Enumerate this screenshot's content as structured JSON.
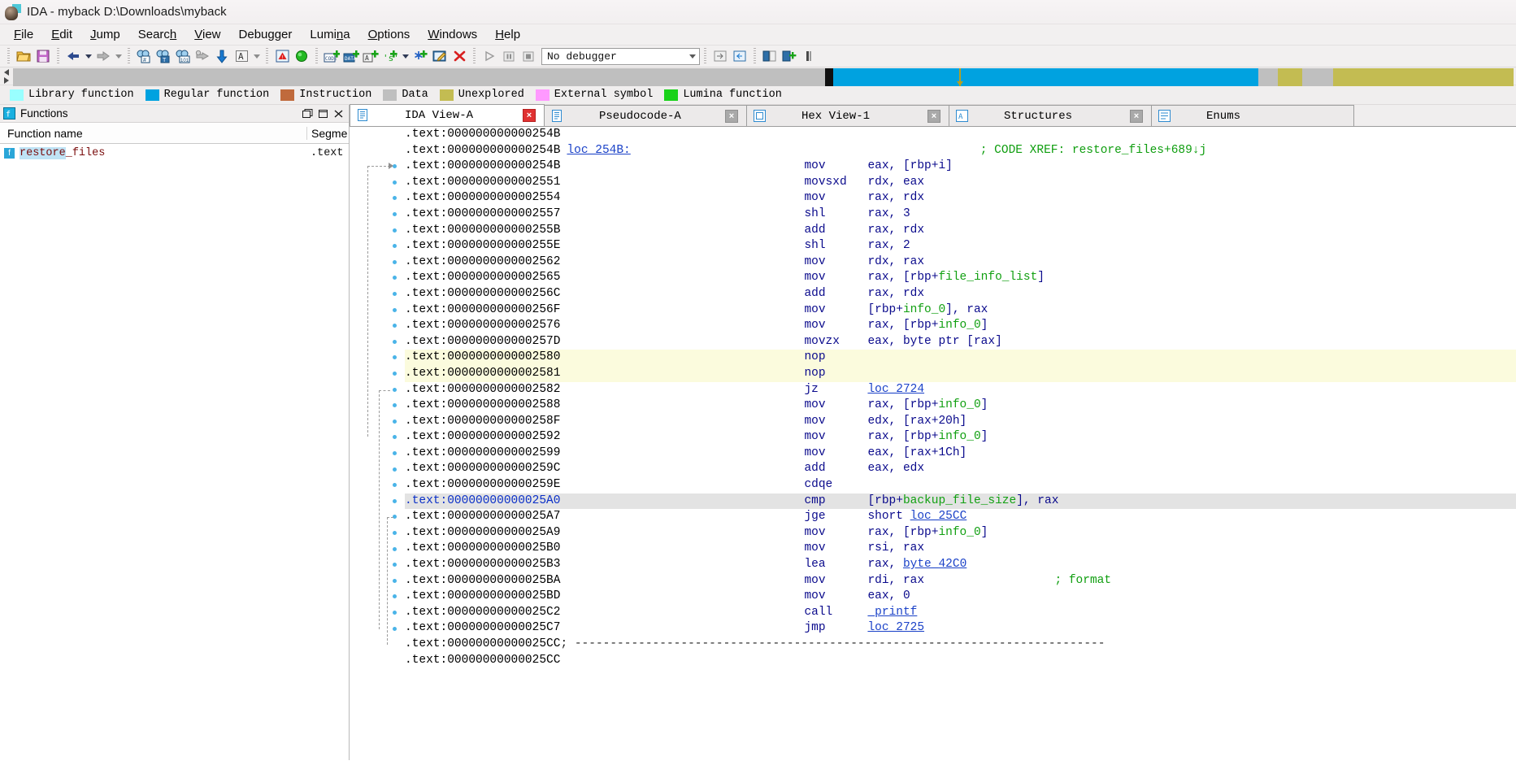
{
  "window": {
    "title": "IDA - myback D:\\Downloads\\myback",
    "icon": "ida-logo-icon"
  },
  "menubar": {
    "items": [
      {
        "label": "File",
        "accel": "F"
      },
      {
        "label": "Edit",
        "accel": "E"
      },
      {
        "label": "Jump",
        "accel": "J"
      },
      {
        "label": "Search",
        "accel": "h"
      },
      {
        "label": "View",
        "accel": "V"
      },
      {
        "label": "Debugger",
        "accel": "g"
      },
      {
        "label": "Lumina",
        "accel": "n"
      },
      {
        "label": "Options",
        "accel": "O"
      },
      {
        "label": "Windows",
        "accel": "W"
      },
      {
        "label": "Help",
        "accel": "H"
      }
    ]
  },
  "toolbar": {
    "open_label": "open-file",
    "save_label": "save",
    "back_label": "jump-back",
    "forward_label": "jump-forward",
    "search_code_label": "search-code",
    "search_text_label": "search-text",
    "search_seq_label": "search-sequence-of-bytes",
    "jump_xref_label": "jump-to-xref",
    "jump_down_label": "jump-to-address",
    "ascii_label": "ascii-string",
    "break_label": "breakpoint",
    "run_label": "run",
    "make_code_label": "make-code",
    "make_data_label": "make-data",
    "make_array_label": "make-array",
    "make_string_label": "make-string",
    "make_struct_label": "make-struct",
    "edit_label": "edit-function",
    "delete_label": "delete-function",
    "dbg_run_label": "debugger-run",
    "dbg_pause_label": "debugger-pause",
    "dbg_stop_label": "debugger-stop",
    "debugger_selected": "No debugger"
  },
  "navband": {
    "segments": [
      {
        "color": "#bfbfbf",
        "width_pct": 31.2,
        "name": "unexplored-region"
      },
      {
        "color": "#bfbfbf",
        "width_pct": 22.9,
        "name": "unexplored-region"
      },
      {
        "color": "#101010",
        "width_pct": 0.55,
        "name": "separator-region"
      },
      {
        "color": "#00a2e0",
        "width_pct": 16.6,
        "name": "regular-function-region"
      },
      {
        "color": "#00a2e0",
        "width_pct": 11.7,
        "name": "regular-function-region"
      },
      {
        "color": "#bfbfbf",
        "width_pct": 1.3,
        "name": "data-region"
      },
      {
        "color": "#c3bc52",
        "width_pct": 1.6,
        "name": "unexplored-region"
      },
      {
        "color": "#bfbfbf",
        "width_pct": 2.1,
        "name": "data-region"
      },
      {
        "color": "#c3bc52",
        "width_pct": 12.0,
        "name": "unexplored-region"
      }
    ],
    "cursor_pct": 63.0
  },
  "legend": {
    "items": [
      {
        "label": "Library function",
        "color": "#99ffff"
      },
      {
        "label": "Regular function",
        "color": "#00a2e0"
      },
      {
        "label": "Instruction",
        "color": "#c06a3c"
      },
      {
        "label": "Data",
        "color": "#bfbfbf"
      },
      {
        "label": "Unexplored",
        "color": "#c3bc52"
      },
      {
        "label": "External symbol",
        "color": "#ff99ff"
      },
      {
        "label": "Lumina function",
        "color": "#19d219"
      }
    ]
  },
  "functions_panel": {
    "title": "Functions",
    "icon": "functions-window-icon",
    "window_buttons": [
      "restore-icon",
      "maximize-icon",
      "close-icon"
    ],
    "columns": [
      "Function name",
      "Segme"
    ],
    "rows": [
      {
        "name_prefix": "restore",
        "name_suffix": "_files",
        "segment": ".text",
        "icon": "function-icon"
      }
    ]
  },
  "tabs": [
    {
      "label": "IDA View-A",
      "icon": "disassembly-icon",
      "active": true,
      "close": "close-icon"
    },
    {
      "label": "Pseudocode-A",
      "icon": "pseudocode-icon",
      "active": false,
      "close": "close-icon"
    },
    {
      "label": "Hex View-1",
      "icon": "hexview-icon",
      "active": false,
      "close": "close-icon"
    },
    {
      "label": "Structures",
      "icon": "structures-icon",
      "active": false,
      "close": "close-icon"
    },
    {
      "label": "Enums",
      "icon": "enums-icon",
      "active": false,
      "close": null
    }
  ],
  "disassembly": {
    "segment": ".text",
    "lines": [
      {
        "addr": ".text:000000000000254B",
        "text": "",
        "kind": "blank"
      },
      {
        "addr": ".text:000000000000254B",
        "label": "loc_254B:",
        "comment": "; CODE XREF: restore_files+689↓j",
        "kind": "label"
      },
      {
        "addr": ".text:000000000000254B",
        "mnemonic": "mov",
        "operands": "eax, [rbp+i]",
        "dot": true,
        "kind": "insn"
      },
      {
        "addr": ".text:0000000000002551",
        "mnemonic": "movsxd",
        "operands": "rdx, eax",
        "dot": true,
        "kind": "insn"
      },
      {
        "addr": ".text:0000000000002554",
        "mnemonic": "mov",
        "operands": "rax, rdx",
        "dot": true,
        "kind": "insn"
      },
      {
        "addr": ".text:0000000000002557",
        "mnemonic": "shl",
        "operands": "rax, 3",
        "dot": true,
        "kind": "insn"
      },
      {
        "addr": ".text:000000000000255B",
        "mnemonic": "add",
        "operands": "rax, rdx",
        "dot": true,
        "kind": "insn"
      },
      {
        "addr": ".text:000000000000255E",
        "mnemonic": "shl",
        "operands": "rax, 2",
        "dot": true,
        "kind": "insn"
      },
      {
        "addr": ".text:0000000000002562",
        "mnemonic": "mov",
        "operands": "rdx, rax",
        "dot": true,
        "kind": "insn"
      },
      {
        "addr": ".text:0000000000002565",
        "mnemonic": "mov",
        "operands": "rax, [rbp+file_info_list]",
        "var": "file_info_list",
        "dot": true,
        "kind": "insn"
      },
      {
        "addr": ".text:000000000000256C",
        "mnemonic": "add",
        "operands": "rax, rdx",
        "dot": true,
        "kind": "insn"
      },
      {
        "addr": ".text:000000000000256F",
        "mnemonic": "mov",
        "operands": "[rbp+info_0], rax",
        "var": "info_0",
        "dot": true,
        "kind": "insn"
      },
      {
        "addr": ".text:0000000000002576",
        "mnemonic": "mov",
        "operands": "rax, [rbp+info_0]",
        "var": "info_0",
        "dot": true,
        "kind": "insn"
      },
      {
        "addr": ".text:000000000000257D",
        "mnemonic": "movzx",
        "operands": "eax, byte ptr [rax]",
        "dot": true,
        "kind": "insn"
      },
      {
        "addr": ".text:0000000000002580",
        "mnemonic": "nop",
        "operands": "",
        "dot": true,
        "kind": "insn",
        "highlight": "yellow"
      },
      {
        "addr": ".text:0000000000002581",
        "mnemonic": "nop",
        "operands": "",
        "dot": true,
        "kind": "insn",
        "highlight": "yellow"
      },
      {
        "addr": ".text:0000000000002582",
        "mnemonic": "jz",
        "operands": "loc_2724",
        "jump": true,
        "dot": true,
        "kind": "insn"
      },
      {
        "addr": ".text:0000000000002588",
        "mnemonic": "mov",
        "operands": "rax, [rbp+info_0]",
        "var": "info_0",
        "dot": true,
        "kind": "insn"
      },
      {
        "addr": ".text:000000000000258F",
        "mnemonic": "mov",
        "operands": "edx, [rax+20h]",
        "dot": true,
        "kind": "insn"
      },
      {
        "addr": ".text:0000000000002592",
        "mnemonic": "mov",
        "operands": "rax, [rbp+info_0]",
        "var": "info_0",
        "dot": true,
        "kind": "insn"
      },
      {
        "addr": ".text:0000000000002599",
        "mnemonic": "mov",
        "operands": "eax, [rax+1Ch]",
        "dot": true,
        "kind": "insn"
      },
      {
        "addr": ".text:000000000000259C",
        "mnemonic": "add",
        "operands": "eax, edx",
        "dot": true,
        "kind": "insn"
      },
      {
        "addr": ".text:000000000000259E",
        "mnemonic": "cdqe",
        "operands": "",
        "dot": true,
        "kind": "insn"
      },
      {
        "addr": ".text:00000000000025A0",
        "mnemonic": "cmp",
        "operands": "[rbp+backup_file_size], rax",
        "var": "backup_file_size",
        "dot": true,
        "kind": "insn",
        "highlight": "selected"
      },
      {
        "addr": ".text:00000000000025A7",
        "mnemonic": "jge",
        "operands": "short loc_25CC",
        "jump": true,
        "dot": true,
        "kind": "insn"
      },
      {
        "addr": ".text:00000000000025A9",
        "mnemonic": "mov",
        "operands": "rax, [rbp+info_0]",
        "var": "info_0",
        "dot": true,
        "kind": "insn"
      },
      {
        "addr": ".text:00000000000025B0",
        "mnemonic": "mov",
        "operands": "rsi, rax",
        "dot": true,
        "kind": "insn"
      },
      {
        "addr": ".text:00000000000025B3",
        "mnemonic": "lea",
        "operands": "rax, byte_42C0",
        "jump": true,
        "dot": true,
        "kind": "insn"
      },
      {
        "addr": ".text:00000000000025BA",
        "mnemonic": "mov",
        "operands": "rdi, rax",
        "comment": "; format",
        "dot": true,
        "kind": "insn"
      },
      {
        "addr": ".text:00000000000025BD",
        "mnemonic": "mov",
        "operands": "eax, 0",
        "dot": true,
        "kind": "insn"
      },
      {
        "addr": ".text:00000000000025C2",
        "mnemonic": "call",
        "operands": "_printf",
        "jump": true,
        "dot": true,
        "kind": "insn"
      },
      {
        "addr": ".text:00000000000025C7",
        "mnemonic": "jmp",
        "operands": "loc_2725",
        "jump": true,
        "dot": true,
        "kind": "insn"
      },
      {
        "addr": ".text:00000000000025CC",
        "separator": "; ---------------------------------------------------------------------------",
        "kind": "sep"
      },
      {
        "addr": ".text:00000000000025CC",
        "text": "",
        "kind": "blank"
      }
    ]
  }
}
